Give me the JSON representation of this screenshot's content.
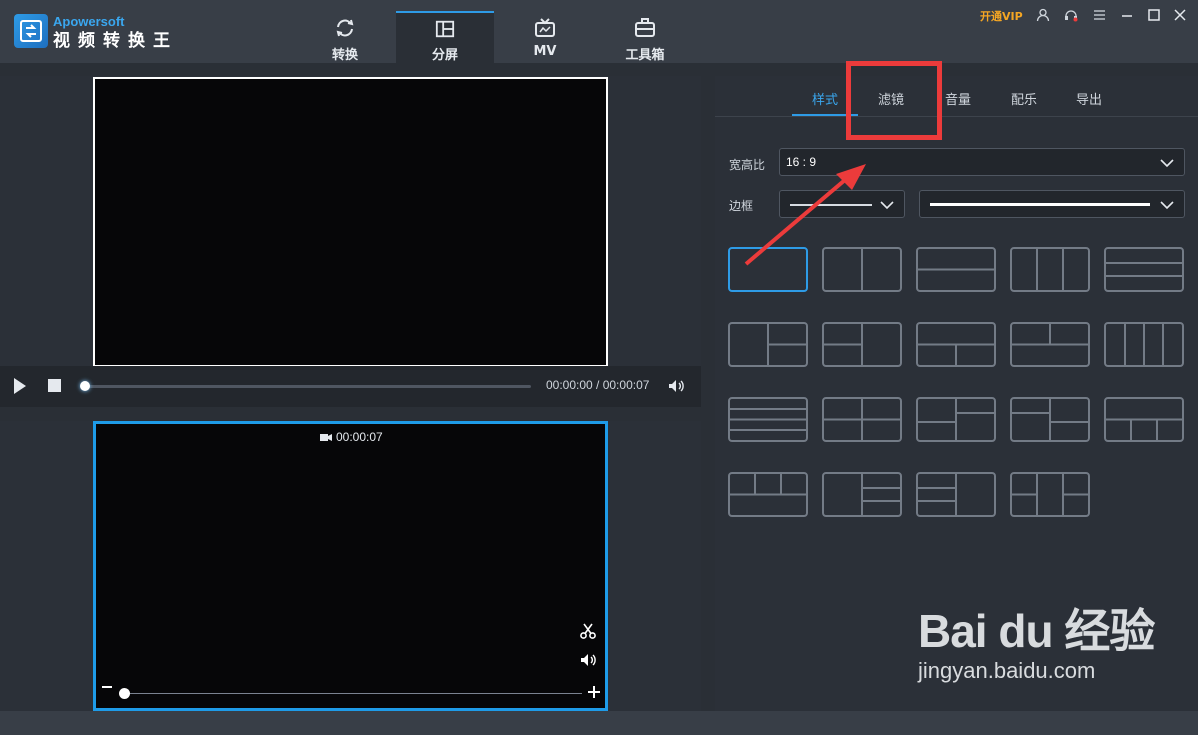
{
  "app": {
    "brand_en": "Apowersoft",
    "brand_cn": "视频转换王",
    "accent": "#2e9be6"
  },
  "nav": {
    "tabs": [
      {
        "label": "转换",
        "icon": "refresh-icon"
      },
      {
        "label": "分屏",
        "icon": "split-screen-icon",
        "active": true
      },
      {
        "label": "MV",
        "icon": "tv-icon"
      },
      {
        "label": "工具箱",
        "icon": "toolbox-icon"
      }
    ]
  },
  "header": {
    "vip_label": "开通VIP",
    "vip_color": "#f5a623",
    "icons": [
      "user-icon",
      "support-icon",
      "menu-icon",
      "minimize-icon",
      "maximize-icon",
      "close-icon"
    ]
  },
  "player": {
    "time": "00:00:00 / 00:00:07",
    "progress": 0
  },
  "clip": {
    "duration": "00:00:07",
    "zoom": 0
  },
  "panel": {
    "tabs": [
      "样式",
      "滤镜",
      "音量",
      "配乐",
      "导出"
    ],
    "active_tab": "样式",
    "aspect_label": "宽高比",
    "aspect_value": "16 : 9",
    "border_label": "边框"
  },
  "layouts": {
    "count": 19,
    "selected_index": 0
  },
  "watermark": {
    "logo": "Bai du 经验",
    "url": "jingyan.baidu.com"
  },
  "annotation": {
    "color": "#ec3b3b"
  }
}
